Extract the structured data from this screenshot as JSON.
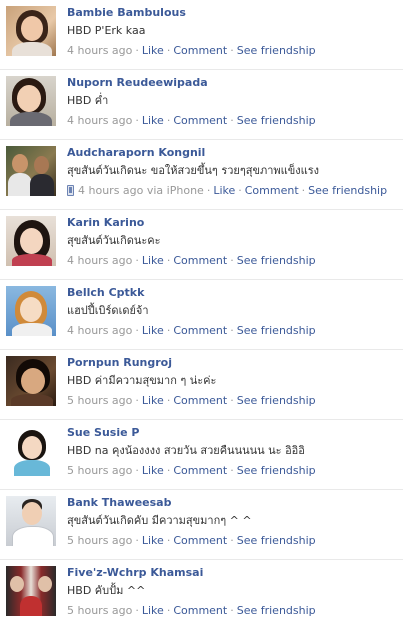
{
  "feed": {
    "posts": [
      {
        "name": "Bambie Bambulous",
        "message": "HBD P'Erk kaa",
        "time": "4 hours ago",
        "via": "",
        "like": "Like",
        "comment": "Comment",
        "friendship": "See friendship"
      },
      {
        "name": "Nuporn Reudeewipada",
        "message": "HBD ค่ำ",
        "time": "4 hours ago",
        "via": "",
        "like": "Like",
        "comment": "Comment",
        "friendship": "See friendship"
      },
      {
        "name": "Audcharaporn Kongnil",
        "message": "สุขสันต์วันเกิดนะ ขอให้สวยขึ้นๆ รวยๆสุขภาพแข็งแรง",
        "time": "4 hours ago via iPhone",
        "via": "iPhone",
        "like": "Like",
        "comment": "Comment",
        "friendship": "See friendship"
      },
      {
        "name": "Karin Karino",
        "message": "สุขสันต์วันเกิดนะคะ",
        "time": "4 hours ago",
        "via": "",
        "like": "Like",
        "comment": "Comment",
        "friendship": "See friendship"
      },
      {
        "name": "Bellch Cptkk",
        "message": "แฮปปี้เบิร์ดเดย์จ้า",
        "time": "4 hours ago",
        "via": "",
        "like": "Like",
        "comment": "Comment",
        "friendship": "See friendship"
      },
      {
        "name": "Pornpun Rungroj",
        "message": "HBD ค่ามีความสุขมาก ๆ น่ะค่ะ",
        "time": "5 hours ago",
        "via": "",
        "like": "Like",
        "comment": "Comment",
        "friendship": "See friendship"
      },
      {
        "name": "Sue Susie P",
        "message": "HBD na คุงน้องงงง สวยวัน สวยคืนนนนน นะ อิอิอิ",
        "time": "5 hours ago",
        "via": "",
        "like": "Like",
        "comment": "Comment",
        "friendship": "See friendship"
      },
      {
        "name": "Bank Thaweesab",
        "message": "สุขสันต์วันเกิดคับ มีความสุขมากๆ ^ ^",
        "time": "5 hours ago",
        "via": "",
        "like": "Like",
        "comment": "Comment",
        "friendship": "See friendship"
      },
      {
        "name": "Five'z-Wchrp Khamsai",
        "message": "HBD คับปั้ม ^^",
        "time": "5 hours ago",
        "via": "",
        "like": "Like",
        "comment": "Comment",
        "friendship": "See friendship"
      }
    ]
  },
  "colors": {
    "link": "#3b5998",
    "meta": "#999999",
    "text": "#333333",
    "divider": "#e9e9e9"
  }
}
